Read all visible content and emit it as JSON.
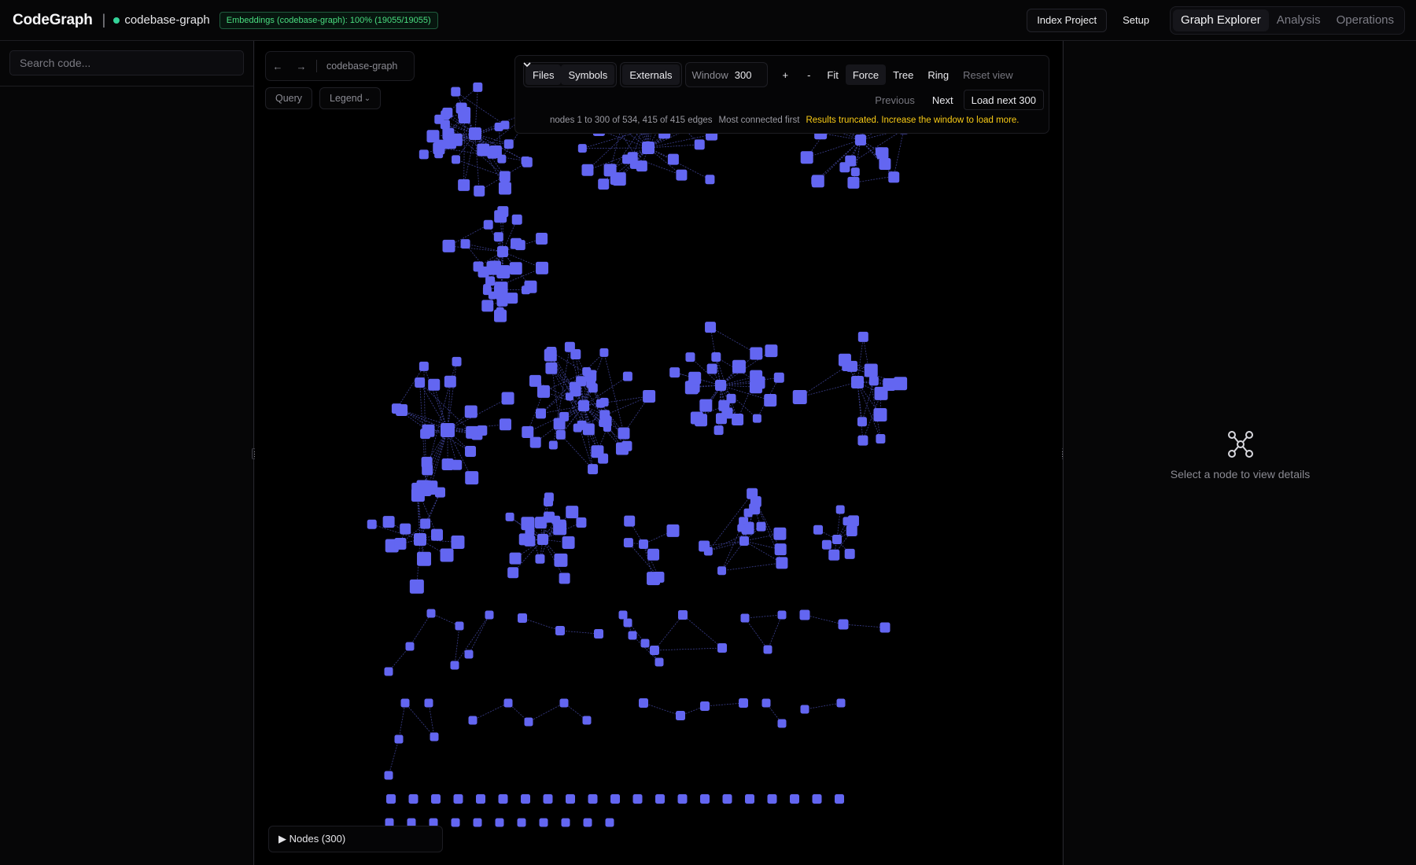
{
  "header": {
    "brand": "CodeGraph",
    "separator": "|",
    "project": "codebase-graph",
    "embeddings_badge": "Embeddings (codebase-graph): 100% (19055/19055)",
    "index_project": "Index Project",
    "setup": "Setup",
    "tabs": [
      {
        "label": "Graph Explorer",
        "active": true
      },
      {
        "label": "Analysis",
        "active": false
      },
      {
        "label": "Operations",
        "active": false
      }
    ]
  },
  "sidebar": {
    "search_placeholder": "Search code..."
  },
  "graph": {
    "nav_back": "←",
    "nav_forward": "→",
    "breadcrumb": "codebase-graph",
    "query_button": "Query",
    "legend_button": "Legend",
    "legend_caret": "⌄",
    "filters": [
      "Files",
      "Symbols",
      "Externals"
    ],
    "window_label": "Window",
    "window_value": "300",
    "zoom_in": "+",
    "zoom_out": "-",
    "fit": "Fit",
    "layouts": [
      "Force",
      "Tree",
      "Ring"
    ],
    "active_layout": "Force",
    "reset_view": "Reset view",
    "previous": "Previous",
    "next": "Next",
    "load_next": "Load next 300",
    "status_nodes": "nodes 1 to 300 of 534, 415 of 415 edges",
    "status_order": "Most connected first",
    "status_warning": "Results truncated. Increase the window to load more.",
    "nodes_toggle": "▶ Nodes (300)",
    "node_color": "#6366f1",
    "edge_color": "#3b3f8f"
  },
  "details": {
    "empty_text": "Select a node to view details",
    "empty_icon": "graph-nodes-icon"
  }
}
